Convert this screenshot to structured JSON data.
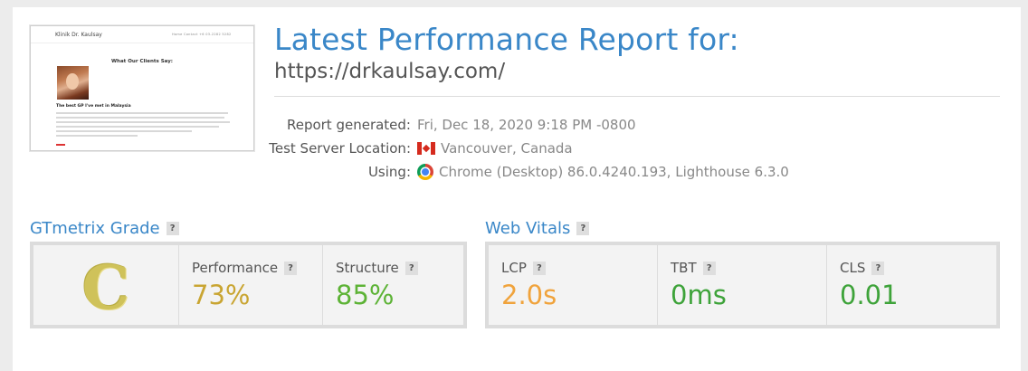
{
  "header": {
    "title": "Latest Performance Report for:",
    "url": "https://drkaulsay.com/"
  },
  "thumbnail": {
    "brand": "Klinik Dr. Kaulsay",
    "nav_links": "Home   Contact        +6 03-2282 5282",
    "heading": "What Our Clients Say:",
    "quote_title": "The best GP I've met in Malaysia"
  },
  "meta": {
    "report_generated_label": "Report generated:",
    "report_generated_value": "Fri, Dec 18, 2020 9:18 PM -0800",
    "location_label": "Test Server Location:",
    "location_value": "Vancouver, Canada",
    "location_flag_icon": "canada-flag-icon",
    "using_label": "Using:",
    "using_value": "Chrome (Desktop) 86.0.4240.193, Lighthouse 6.3.0",
    "using_icon": "chrome-icon"
  },
  "grade_section": {
    "title": "GTmetrix Grade",
    "help": "?",
    "grade": "C",
    "grade_color": "#cfc25a",
    "performance": {
      "label": "Performance",
      "help": "?",
      "value": "73%",
      "color": "#c9a532"
    },
    "structure": {
      "label": "Structure",
      "help": "?",
      "value": "85%",
      "color": "#5db336"
    }
  },
  "vitals_section": {
    "title": "Web Vitals",
    "help": "?",
    "lcp": {
      "label": "LCP",
      "help": "?",
      "value": "2.0s",
      "color": "#f0a33c"
    },
    "tbt": {
      "label": "TBT",
      "help": "?",
      "value": "0ms",
      "color": "#3ea33a"
    },
    "cls": {
      "label": "CLS",
      "help": "?",
      "value": "0.01",
      "color": "#3ea33a"
    }
  }
}
